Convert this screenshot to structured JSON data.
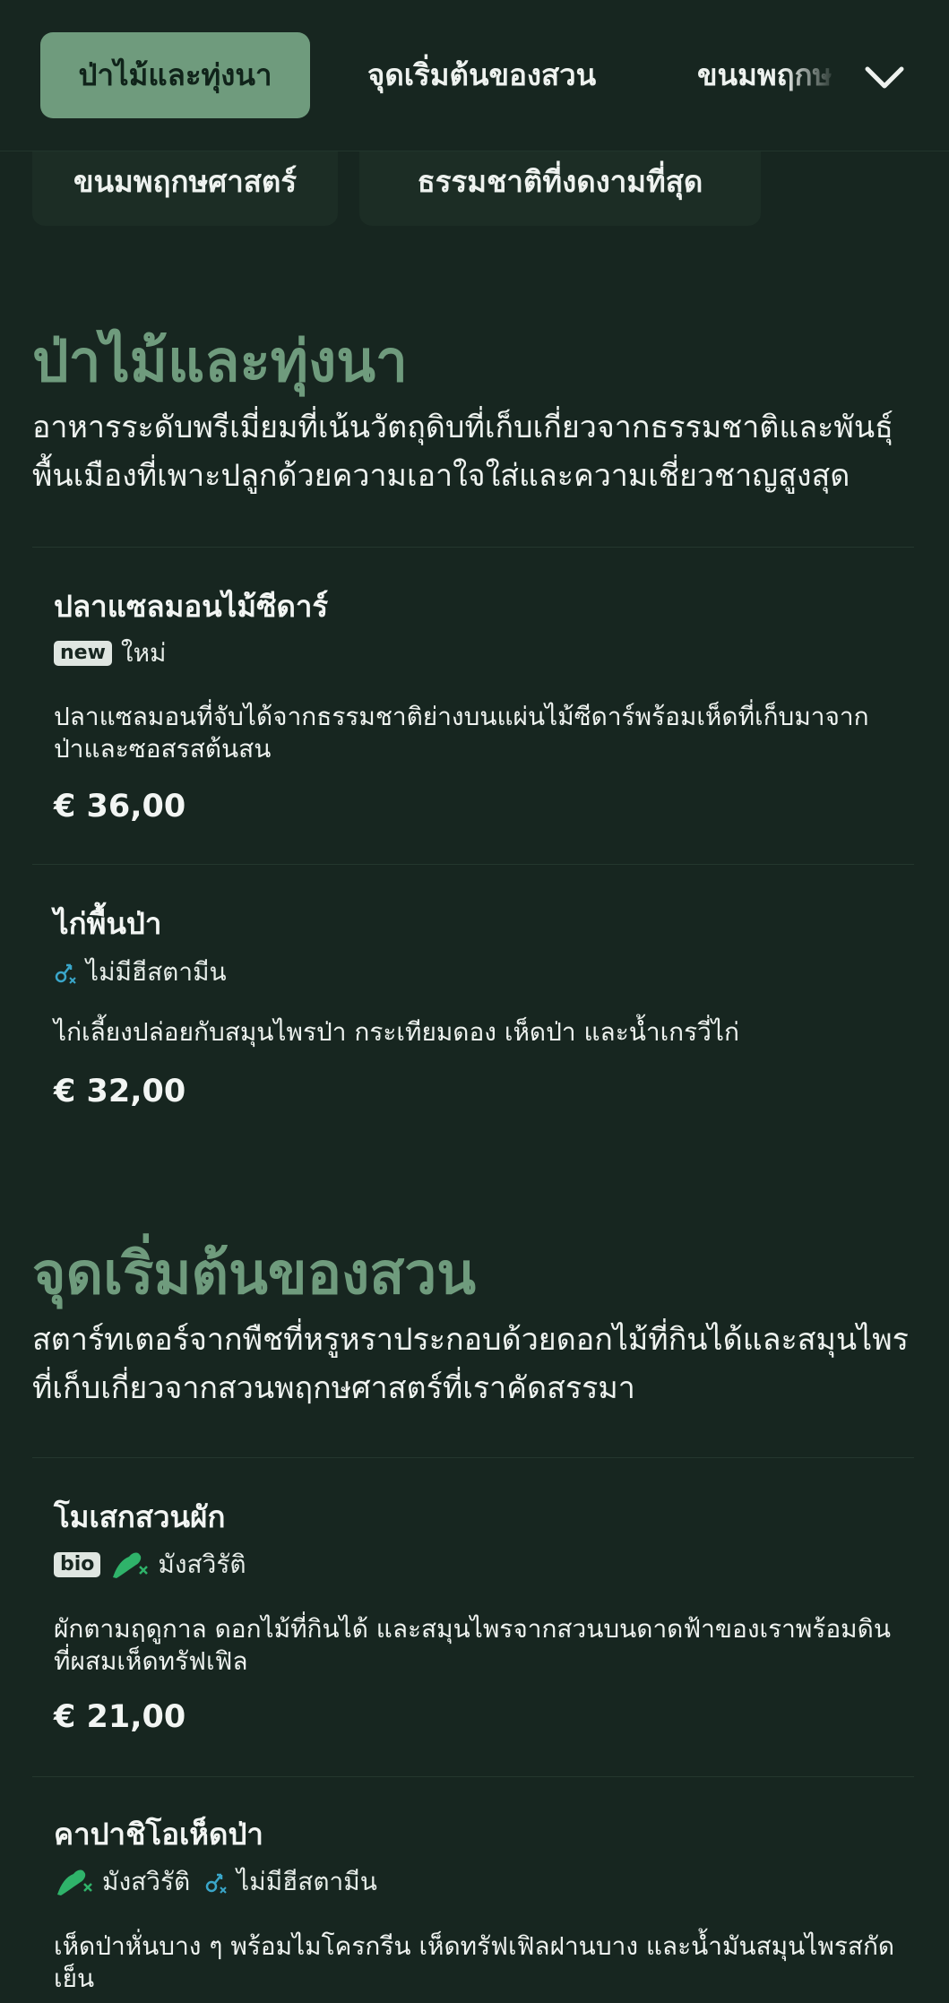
{
  "nav": {
    "tabs": [
      {
        "label": "ป่าไม้และทุ่งนา"
      },
      {
        "label": "จุดเริ่มต้นของสวน"
      },
      {
        "label": "ขนมพฤกษ"
      }
    ],
    "chevron_icon": "chevron-down-icon"
  },
  "chips": [
    {
      "label": "ขนมพฤกษศาสตร์"
    },
    {
      "label": "ธรรมชาติที่งดงามที่สุด"
    }
  ],
  "sections": [
    {
      "title": "ป่าไม้และทุ่งนา",
      "description": "อาหารระดับพรีเมี่ยมที่เน้นวัตถุดิบที่เก็บเกี่ยวจากธรรมชาติและพันธุ์พื้นเมืองที่เพาะปลูกด้วยความเอาใจใส่และความเชี่ยวชาญสูงสุด",
      "items": [
        {
          "name": "ปลาแซลมอนไม้ซีดาร์",
          "badge": "new",
          "tag": "ใหม่",
          "description": "ปลาแซลมอนที่จับได้จากธรรมชาติย่างบนแผ่นไม้ซีดาร์พร้อมเห็ดที่เก็บมาจากป่าและซอสรสต้นสน",
          "price": "€ 36,00"
        },
        {
          "name": "ไก่พื้นป่า",
          "tag_icon": "histamine-free-icon",
          "tag": "ไม่มีฮีสตามีน",
          "description": "ไก่เลี้ยงปล่อยกับสมุนไพรป่า กระเทียมดอง เห็ดป่า และน้ำเกรวี่ไก่",
          "price": "€ 32,00"
        }
      ]
    },
    {
      "title": "จุดเริ่มต้นของสวน",
      "description": "สตาร์ทเตอร์จากพืชที่หรูหราประกอบด้วยดอกไม้ที่กินได้และสมุนไพรที่เก็บเกี่ยวจากสวนพฤกษศาสตร์ที่เราคัดสรรมา",
      "items": [
        {
          "name": "โมเสกสวนผัก",
          "badge": "bio",
          "tag_icon": "vegetarian-icon",
          "tag": "มังสวิรัติ",
          "description": "ผักตามฤดูกาล ดอกไม้ที่กินได้ และสมุนไพรจากสวนบนดาดฟ้าของเราพร้อมดินที่ผสมเห็ดทรัฟเฟิล",
          "price": "€ 21,00"
        },
        {
          "name": "คาปาชิโอเห็ดป่า",
          "tag_icon": "vegetarian-icon",
          "tag": "มังสวิรัติ",
          "tag2_icon": "histamine-free-icon",
          "tag2": "ไม่มีฮีสตามีน",
          "description": "เห็ดป่าหั่นบาง ๆ พร้อมไมโครกรีน เห็ดทรัฟเฟิลฝานบาง และน้ำมันสมุนไพรสกัดเย็น"
        }
      ]
    }
  ],
  "colors": {
    "background": "#172620",
    "accent": "#6f9b7d",
    "vegetarian_icon": "#2fb36a",
    "histamine_icon": "#3aa6c9"
  }
}
